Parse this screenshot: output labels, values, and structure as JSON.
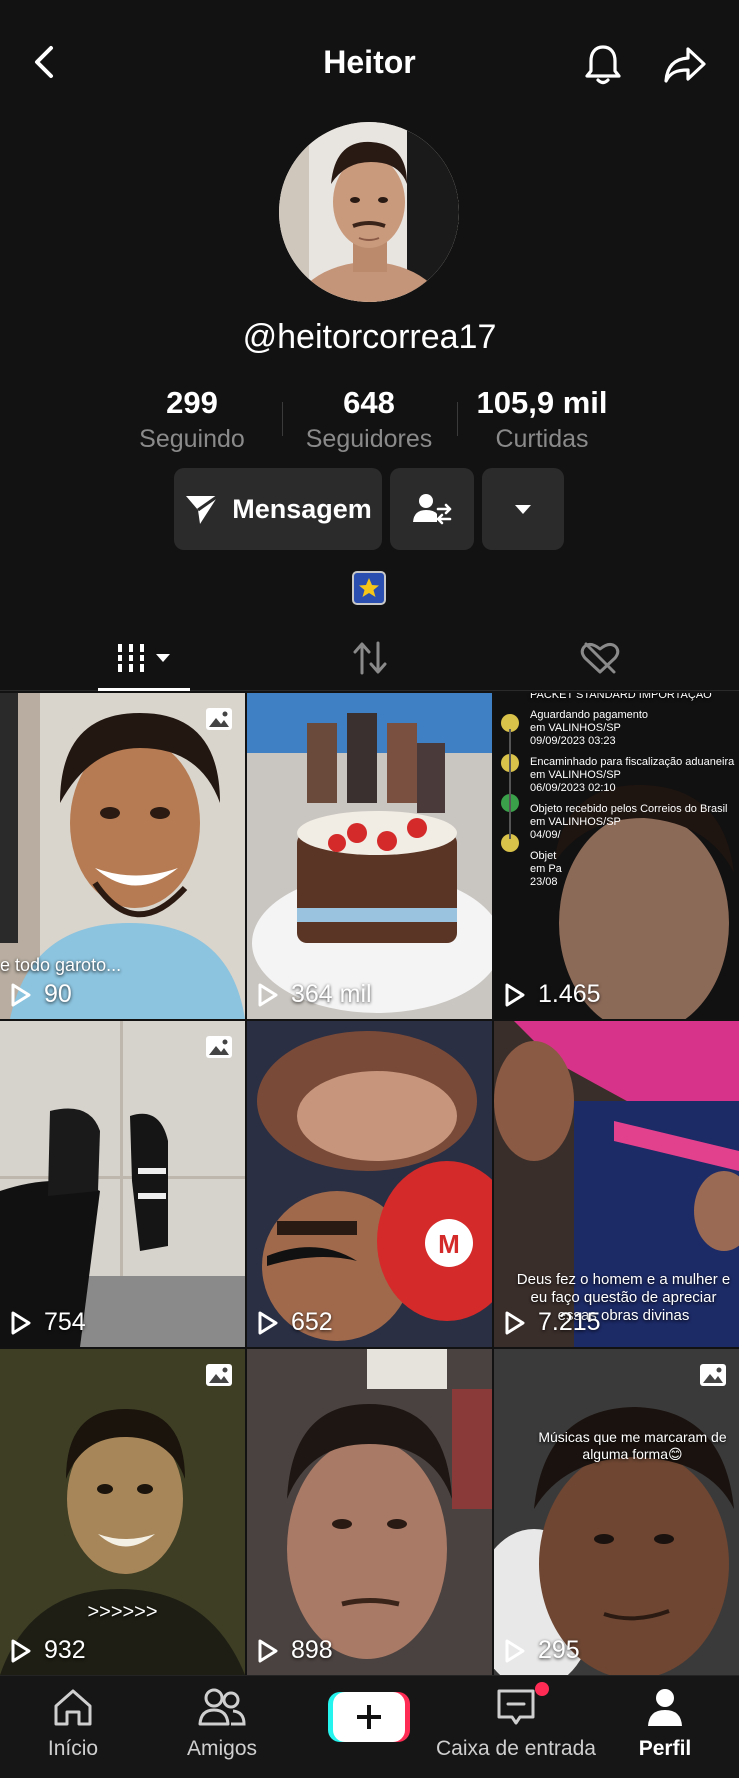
{
  "header": {
    "title": "Heitor",
    "back_icon": "chevron-left-icon",
    "bell_icon": "bell-icon",
    "share_icon": "share-arrow-icon"
  },
  "profile": {
    "username": "@heitorcorrea17",
    "stats": [
      {
        "value": "299",
        "label": "Seguindo"
      },
      {
        "value": "648",
        "label": "Seguidores"
      },
      {
        "value": "105,9 mil",
        "label": "Curtidas"
      }
    ],
    "message_button": "Mensagem",
    "badge_icon": "star-emoji-icon"
  },
  "tabs": [
    {
      "name": "videos",
      "icon": "grid-bars-icon",
      "active": true
    },
    {
      "name": "reposts",
      "icon": "repost-icon",
      "active": false
    },
    {
      "name": "liked",
      "icon": "heart-hidden-icon",
      "active": false
    }
  ],
  "grid": [
    {
      "views": "90",
      "photo": true,
      "caption": "e todo garoto..."
    },
    {
      "views": "364 mil",
      "photo": false,
      "caption": ""
    },
    {
      "views": "1.465",
      "photo": false,
      "caption": "PACKET STANDARD IMPORTAÇÃO"
    },
    {
      "views": "754",
      "photo": true,
      "caption": ""
    },
    {
      "views": "652",
      "photo": false,
      "caption": ""
    },
    {
      "views": "7.215",
      "photo": false,
      "caption": "Deus fez o homem e a mulher e eu faço questão de apreciar essas obras divinas"
    },
    {
      "views": "932",
      "photo": true,
      "caption": ">>>>>>"
    },
    {
      "views": "898",
      "photo": false,
      "caption": ""
    },
    {
      "views": "295",
      "photo": true,
      "caption": "Músicas que me marcaram de alguma forma😊"
    }
  ],
  "tracking_lines": [
    "Aguardando pagamento",
    "em VALINHOS/SP",
    "09/09/2023 03:23",
    "Encaminhado para fiscalização aduaneira",
    "em VALINHOS/SP",
    "06/09/2023 02:10",
    "Objeto recebido pelos Correios do Brasil",
    "em VALINHOS/SP",
    "04/09/",
    "Objet",
    "em Pa",
    "23/08"
  ],
  "bottom_nav": [
    {
      "label": "Início",
      "icon": "home-icon",
      "active": false
    },
    {
      "label": "Amigos",
      "icon": "friends-icon",
      "active": false
    },
    {
      "label": "",
      "icon": "plus-icon",
      "active": false
    },
    {
      "label": "Caixa de entrada",
      "icon": "inbox-icon",
      "active": false
    },
    {
      "label": "Perfil",
      "icon": "profile-icon",
      "active": true
    }
  ],
  "colors": {
    "background": "#121212",
    "button": "#2b2b2b",
    "muted_text": "#8a8a8a",
    "accent_red": "#fe2c55",
    "accent_cyan": "#25f4ee"
  }
}
